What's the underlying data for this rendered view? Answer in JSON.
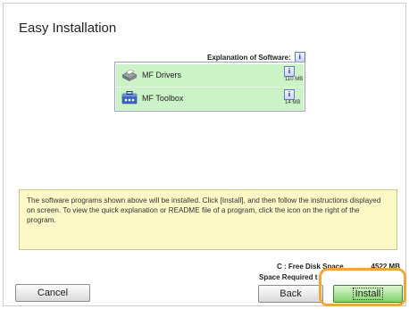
{
  "window": {
    "title": "Easy Installation"
  },
  "explanation": {
    "label": "Explanation of Software:",
    "icon": "info-icon",
    "icon_glyph": "i"
  },
  "software": [
    {
      "name": "MF Drivers",
      "size": "110 MB",
      "icon": "printer-icon",
      "info_glyph": "i"
    },
    {
      "name": "MF Toolbox",
      "size": "14 MB",
      "icon": "toolbox-icon",
      "info_glyph": "i"
    }
  ],
  "note": {
    "text": "The software programs shown above will be installed. Click [Install], and then follow the instructions displayed on screen. To view the quick explanation or README file of a program, click the icon on the right of the program."
  },
  "disk": {
    "free_label": "C : Free Disk Space",
    "free_value": "4522 MB",
    "required_label": "Space Required t"
  },
  "buttons": {
    "cancel": "Cancel",
    "back": "Back",
    "install": "Install"
  },
  "colors": {
    "list_item_bg": "#ccf2c8",
    "note_bg": "#fdf9c7",
    "highlight": "#f0a640",
    "install_button": "#7fd36c"
  }
}
